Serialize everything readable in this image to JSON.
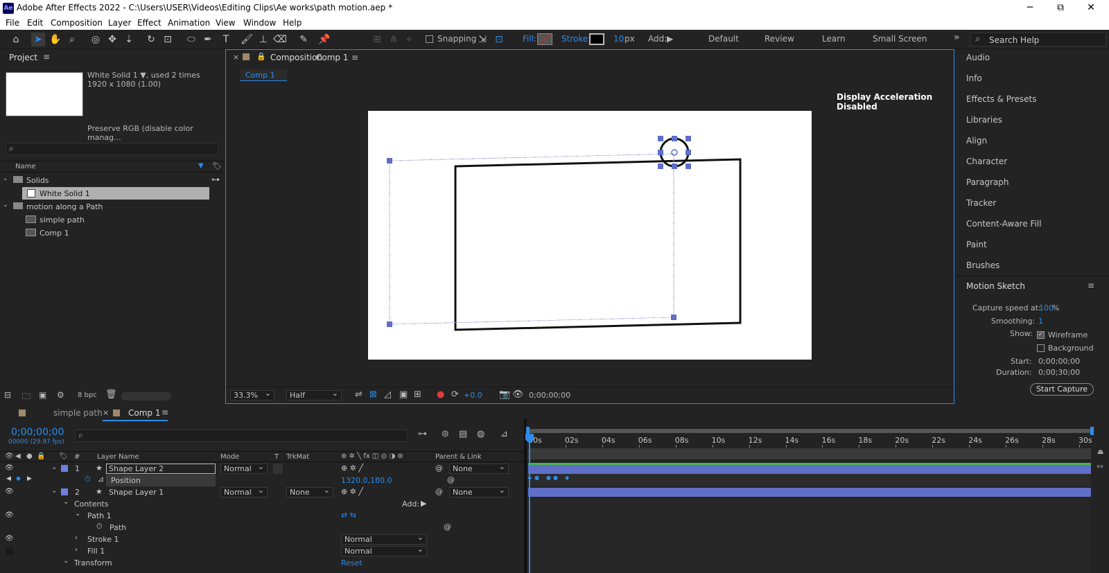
{
  "titlebar": {
    "app_icon": "Ae",
    "title": "Adobe After Effects 2022 - C:\\Users\\USER\\Videos\\Editing Clips\\Ae works\\path motion.aep *",
    "minimize": "─",
    "maximize": "⧉",
    "close": "✕"
  },
  "menu": [
    "File",
    "Edit",
    "Composition",
    "Layer",
    "Effect",
    "Animation",
    "View",
    "Window",
    "Help"
  ],
  "toolbar": {
    "snapping_label": "Snapping",
    "fill_label": "Fill:",
    "stroke_label": "Stroke:",
    "stroke_width": "10",
    "stroke_unit": "px",
    "add_label": "Add:",
    "workspaces": [
      "Default",
      "Review",
      "Learn",
      "Small Screen"
    ],
    "overflow": "»",
    "search_placeholder": "Search Help"
  },
  "project": {
    "title": "Project",
    "item_name": "White Solid 1 ▼, used 2 times",
    "item_size": "1920 x 1080 (1.00)",
    "item_note": "Preserve RGB (disable color manag...",
    "search_placeholder": "",
    "col_name": "Name",
    "items": [
      {
        "label": "Solids",
        "type": "folder",
        "indent": 0
      },
      {
        "label": "White Solid 1",
        "type": "solid",
        "indent": 1,
        "selected": true
      },
      {
        "label": "motion along a Path",
        "type": "folder",
        "indent": 0
      },
      {
        "label": "simple path",
        "type": "comp",
        "indent": 1
      },
      {
        "label": "Comp 1",
        "type": "comp",
        "indent": 1
      }
    ],
    "bpc": "8 bpc"
  },
  "composition": {
    "tab_prefix": "Composition",
    "tab_name": "Comp 1",
    "breadcrumb": "Comp 1",
    "notice": "Display Acceleration Disabled",
    "zoom": "33.3%",
    "resolution": "Half",
    "exposure": "+0.0",
    "timecode": "0;00;00;00"
  },
  "right_panels": [
    "Audio",
    "Info",
    "Effects & Presets",
    "Libraries",
    "Align",
    "Character",
    "Paragraph",
    "Tracker",
    "Content-Aware Fill",
    "Paint",
    "Brushes"
  ],
  "motion_sketch": {
    "title": "Motion Sketch",
    "capture_speed_label": "Capture speed at:",
    "capture_speed_value": "100",
    "capture_speed_unit": "%",
    "smoothing_label": "Smoothing:",
    "smoothing_value": "1",
    "show_label": "Show:",
    "wireframe": "Wireframe",
    "background": "Background",
    "start_label": "Start:",
    "start_value": "0;00;00;00",
    "duration_label": "Duration:",
    "duration_value": "0;00;30;00",
    "start_button": "Start Capture"
  },
  "timeline": {
    "tabs": [
      "simple path",
      "Comp 1"
    ],
    "timecode": "0;00;00;00",
    "frame_info": "00000 (29.97 fps)",
    "columns": {
      "hash": "#",
      "layer_name": "Layer Name",
      "mode": "Mode",
      "t": "T",
      "trkmat": "TrkMat",
      "parent": "Parent & Link"
    },
    "ruler": [
      "00s",
      "02s",
      "04s",
      "06s",
      "08s",
      "10s",
      "12s",
      "14s",
      "16s",
      "18s",
      "20s",
      "22s",
      "24s",
      "26s",
      "28s",
      "30s"
    ],
    "layers": [
      {
        "num": "1",
        "name": "Shape Layer 2",
        "mode": "Normal",
        "trkmat": "",
        "parent": "None"
      },
      {
        "name": "Position",
        "value": "1320.0,180.0"
      },
      {
        "num": "2",
        "name": "Shape Layer 1",
        "mode": "Normal",
        "trkmat": "None",
        "parent": "None"
      }
    ],
    "contents": "Contents",
    "add_label": "Add:",
    "path1": "Path 1",
    "path": "Path",
    "stroke1": "Stroke 1",
    "stroke1_mode": "Normal",
    "fill1": "Fill 1",
    "fill1_mode": "Normal",
    "transform": "Transform",
    "reset": "Reset"
  },
  "colors": {
    "accent": "#2d8ceb",
    "layer_bar": "#5f6ec7",
    "label_blue": "#6e7fe0",
    "green_bar": "#46b446"
  }
}
